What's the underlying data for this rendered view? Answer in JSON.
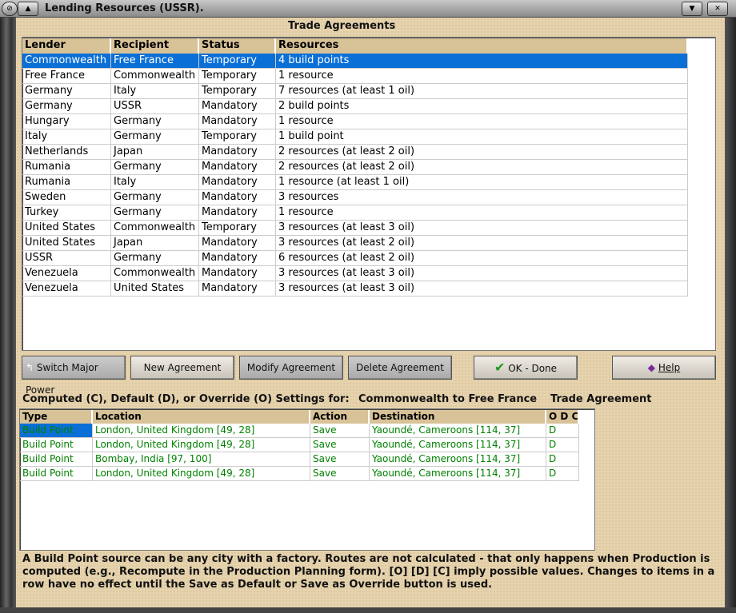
{
  "window": {
    "title": "Lending Resources (USSR)."
  },
  "trade": {
    "title": "Trade Agreements",
    "columns": [
      "Lender",
      "Recipient",
      "Status",
      "Resources"
    ],
    "rows": [
      [
        "Commonwealth",
        "Free France",
        "Temporary",
        "4 build points"
      ],
      [
        "Free France",
        "Commonwealth",
        "Temporary",
        "1 resource"
      ],
      [
        "Germany",
        "Italy",
        "Temporary",
        "7 resources (at least 1 oil)"
      ],
      [
        "Germany",
        "USSR",
        "Mandatory",
        "2 build points"
      ],
      [
        "Hungary",
        "Germany",
        "Mandatory",
        "1 resource"
      ],
      [
        "Italy",
        "Germany",
        "Temporary",
        "1 build point"
      ],
      [
        "Netherlands",
        "Japan",
        "Mandatory",
        "2 resources (at least 2 oil)"
      ],
      [
        "Rumania",
        "Germany",
        "Mandatory",
        "2 resources (at least 2 oil)"
      ],
      [
        "Rumania",
        "Italy",
        "Mandatory",
        "1 resource (at least 1 oil)"
      ],
      [
        "Sweden",
        "Germany",
        "Mandatory",
        "3 resources"
      ],
      [
        "Turkey",
        "Germany",
        "Mandatory",
        "1 resource"
      ],
      [
        "United States",
        "Commonwealth",
        "Temporary",
        "3 resources (at least 3 oil)"
      ],
      [
        "United States",
        "Japan",
        "Mandatory",
        "3 resources (at least 2 oil)"
      ],
      [
        "USSR",
        "Germany",
        "Mandatory",
        "6 resources (at least 2 oil)"
      ],
      [
        "Venezuela",
        "Commonwealth",
        "Mandatory",
        "3 resources (at least 3 oil)"
      ],
      [
        "Venezuela",
        "United States",
        "Mandatory",
        "3 resources (at least 3 oil)"
      ]
    ]
  },
  "buttons": {
    "switch": "Switch Major Power",
    "new": "New Agreement",
    "modify": "Modify Agreement",
    "delete": "Delete Agreement",
    "ok": "OK - Done",
    "help": "Help"
  },
  "settings": {
    "label": "Computed (C), Default (D), or Override (O) Settings for:",
    "subject": "Commonwealth to Free France",
    "kind": "Trade Agreement",
    "columns": [
      "Type",
      "Location",
      "Action",
      "Destination",
      "O D C"
    ],
    "rows": [
      [
        "Build Point",
        "London, United Kingdom [49, 28]",
        "Save",
        "Yaoundé, Cameroons [114, 37]",
        "D"
      ],
      [
        "Build Point",
        "London, United Kingdom [49, 28]",
        "Save",
        "Yaoundé, Cameroons [114, 37]",
        "D"
      ],
      [
        "Build Point",
        "Bombay, India [97, 100]",
        "Save",
        "Yaoundé, Cameroons [114, 37]",
        "D"
      ],
      [
        "Build Point",
        "London, United Kingdom [49, 28]",
        "Save",
        "Yaoundé, Cameroons [114, 37]",
        "D"
      ]
    ]
  },
  "footer": "A Build Point source can be any city with a factory. Routes are not calculated - that only happens when Production is computed (e.g., Recompute in the Production Planning form).  [O] [D] [C] imply possible values.  Changes to items in a row have no effect until the Save as Default or Save as Override button is used.",
  "colors": {
    "selection": "#0a6fd6",
    "settingsText": "#008000",
    "background": "#e6d3ae"
  }
}
